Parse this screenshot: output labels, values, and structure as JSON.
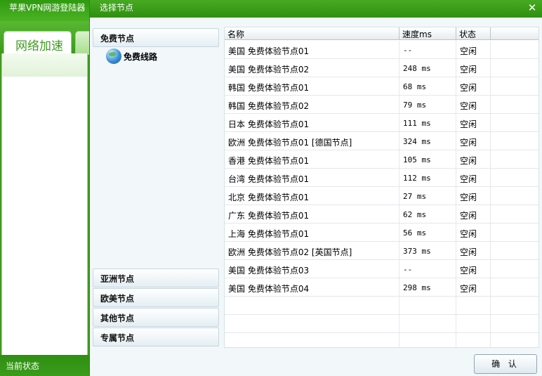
{
  "main_window": {
    "title": "苹果VPN网游登陆器",
    "active_tab": "网络加速",
    "status_label": "当前状态"
  },
  "dialog": {
    "title": "选择节点",
    "close_glyph": "✕",
    "ok_label": "确 认",
    "categories": [
      {
        "label": "免费节点"
      },
      {
        "label": "亚洲节点"
      },
      {
        "label": "欧美节点"
      },
      {
        "label": "其他节点"
      },
      {
        "label": "专属节点"
      }
    ],
    "tree_item": {
      "label": "免费线路",
      "icon": "globe-icon"
    },
    "table": {
      "headers": {
        "name": "名称",
        "speed": "速度ms",
        "status": "状态"
      },
      "rows": [
        {
          "name": "美国 免费体验节点01",
          "speed": "--",
          "status": "空闲"
        },
        {
          "name": "美国 免费体验节点02",
          "speed": "248 ms",
          "status": "空闲"
        },
        {
          "name": "韩国 免费体验节点01",
          "speed": "68 ms",
          "status": "空闲"
        },
        {
          "name": "韩国 免费体验节点02",
          "speed": "79 ms",
          "status": "空闲"
        },
        {
          "name": "日本 免费体验节点01",
          "speed": "111 ms",
          "status": "空闲"
        },
        {
          "name": "欧洲 免费体验节点01 [德国节点]",
          "speed": "324 ms",
          "status": "空闲"
        },
        {
          "name": "香港 免费体验节点01",
          "speed": "105 ms",
          "status": "空闲"
        },
        {
          "name": "台湾 免费体验节点01",
          "speed": "112 ms",
          "status": "空闲"
        },
        {
          "name": "北京 免费体验节点01",
          "speed": "27 ms",
          "status": "空闲"
        },
        {
          "name": "广东 免费体验节点01",
          "speed": "62 ms",
          "status": "空闲"
        },
        {
          "name": "上海 免费体验节点01",
          "speed": "56 ms",
          "status": "空闲"
        },
        {
          "name": "欧洲 免费体验节点02 [英国节点]",
          "speed": "373 ms",
          "status": "空闲"
        },
        {
          "name": "美国 免费体验节点03",
          "speed": "--",
          "status": "空闲"
        },
        {
          "name": "美国 免费体验节点04",
          "speed": "298 ms",
          "status": "空闲"
        }
      ],
      "empty_row_count": 3
    }
  },
  "colors": {
    "brand_green": "#3f9a1d",
    "dialog_bg": "#f2f7fa"
  }
}
